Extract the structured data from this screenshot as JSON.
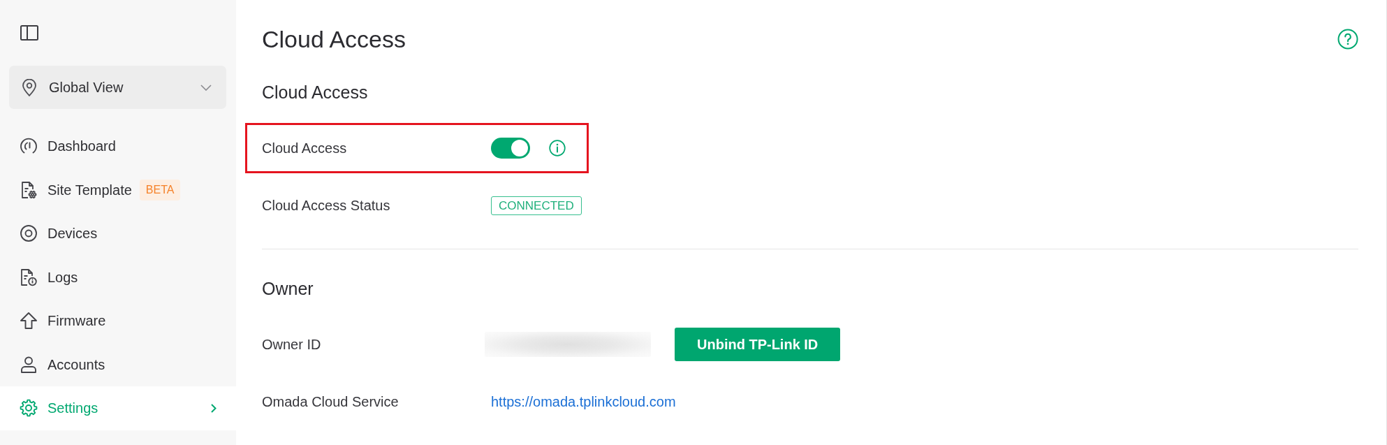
{
  "sidebar": {
    "selector": {
      "label": "Global View"
    },
    "items": [
      {
        "label": "Dashboard",
        "selected": false
      },
      {
        "label": "Site Template",
        "badge": "BETA",
        "selected": false
      },
      {
        "label": "Devices",
        "selected": false
      },
      {
        "label": "Logs",
        "selected": false
      },
      {
        "label": "Firmware",
        "selected": false
      },
      {
        "label": "Accounts",
        "selected": false
      },
      {
        "label": "Settings",
        "selected": true
      }
    ]
  },
  "page": {
    "title": "Cloud Access"
  },
  "sections": [
    {
      "title": "Cloud Access",
      "rows": [
        {
          "kind": "switch",
          "label": "Cloud Access",
          "on": true,
          "highlighted": true
        },
        {
          "kind": "status",
          "label": "Cloud Access Status",
          "value": "CONNECTED",
          "highlighted": false
        }
      ]
    },
    {
      "title": "Owner",
      "rows": [
        {
          "kind": "redacted",
          "label": "Owner ID",
          "button": "Unbind TP-Link ID",
          "highlighted": false
        },
        {
          "kind": "link",
          "label": "Omada Cloud Service",
          "value": "https://omada.tplinkcloud.com",
          "highlighted": false
        }
      ]
    }
  ]
}
